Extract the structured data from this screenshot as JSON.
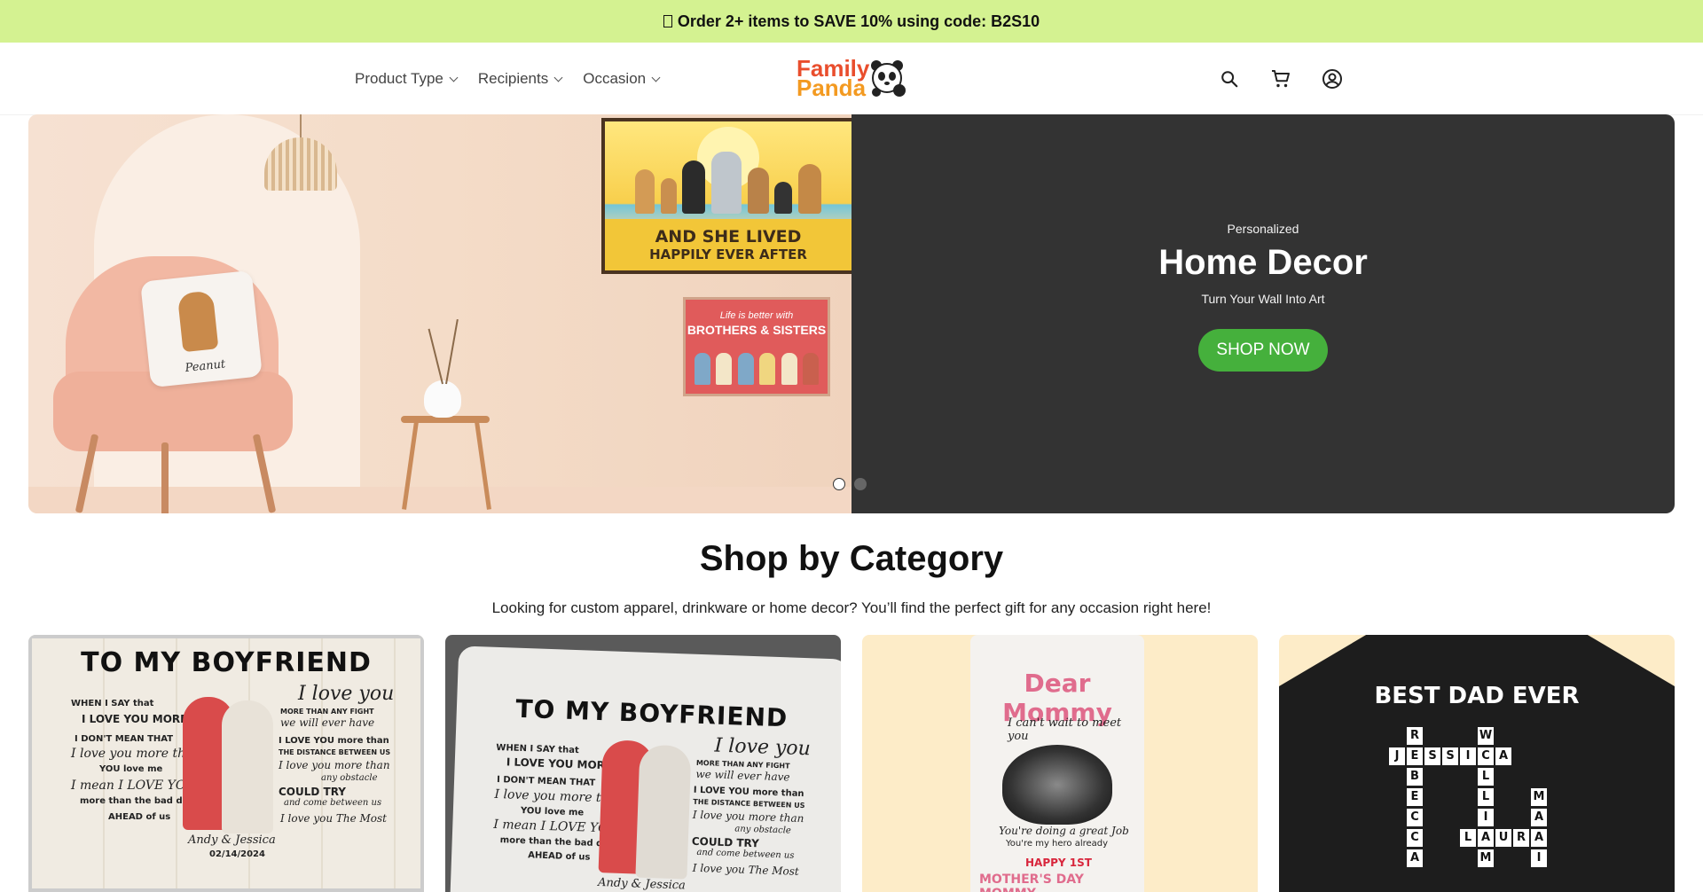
{
  "promo": {
    "text": "Order 2+ items to SAVE 10% using code: B2S10"
  },
  "nav": {
    "items": [
      {
        "label": "Product Type"
      },
      {
        "label": "Recipients"
      },
      {
        "label": "Occasion"
      }
    ]
  },
  "logo": {
    "line1": "Family",
    "line2": "Panda"
  },
  "header_icons": [
    "search-icon",
    "cart-icon",
    "account-icon"
  ],
  "hero": {
    "kicker": "Personalized",
    "title": "Home Decor",
    "subtitle": "Turn Your Wall Into Art",
    "cta": "SHOP NOW",
    "slides": 2,
    "active_slide": 1,
    "image": {
      "poster1_line1": "AND SHE LIVED",
      "poster1_line2": "HAPPILY EVER AFTER",
      "poster2_line1": "Life is better with",
      "poster2_line2": "BROTHERS & SISTERS",
      "pillow_name": "Peanut"
    }
  },
  "category": {
    "title": "Shop by Category",
    "subtitle": "Looking for custom apparel, drinkware or home decor? You’ll find the perfect gift for any occasion right here!",
    "cards": [
      {
        "heading": "TO MY BOYFRIEND",
        "left_lines": [
          "WHEN I SAY that",
          "I LOVE YOU MORE",
          "I DON'T MEAN THAT",
          "I love you more than",
          "YOU love me",
          "I mean I LOVE YOU",
          "more than the bad days",
          "AHEAD of us"
        ],
        "right_lines": [
          "I love you",
          "MORE THAN ANY FIGHT",
          "we will ever have",
          "I LOVE YOU more than",
          "THE DISTANCE BETWEEN US",
          "I love you more than",
          "any obstacle",
          "COULD TRY",
          "and come between us",
          "I love you The Most"
        ],
        "names": "Andy & Jessica",
        "date": "02/14/2024"
      },
      {
        "heading": "TO MY BOYFRIEND",
        "left_lines": [
          "WHEN I SAY that",
          "I LOVE YOU MORE",
          "I DON'T MEAN THAT",
          "I love you more than",
          "YOU love me",
          "I mean I LOVE YOU",
          "more than the bad days",
          "AHEAD of us"
        ],
        "right_lines": [
          "I love you",
          "MORE THAN ANY FIGHT",
          "we will ever have",
          "I LOVE YOU more than",
          "THE DISTANCE BETWEEN US",
          "I love you more than",
          "any obstacle",
          "COULD TRY",
          "and come between us",
          "I love you The Most"
        ],
        "names": "Andy & Jessica"
      },
      {
        "heading": "Dear Mommy",
        "line1": "I can't wait to meet you",
        "line2": "You're doing a great Job",
        "line3": "You're my hero already",
        "line4": "HAPPY 1ST",
        "line5": "MOTHER'S DAY MOMMY"
      },
      {
        "heading": "BEST DAD EVER",
        "words": [
          "JESSICA",
          "LAURA"
        ]
      }
    ]
  }
}
